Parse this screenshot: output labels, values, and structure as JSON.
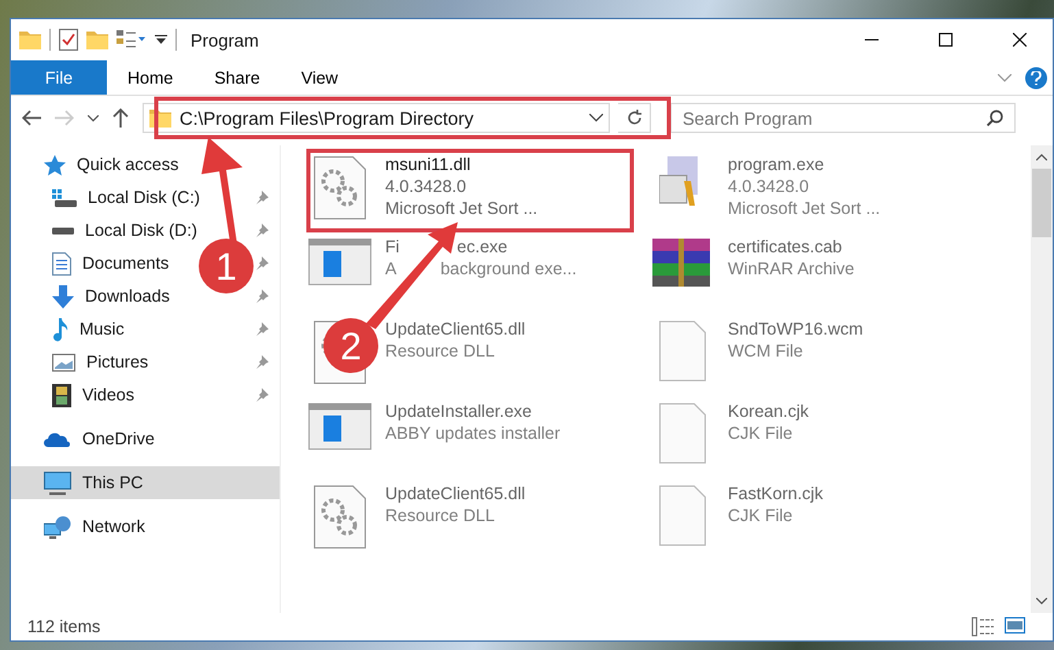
{
  "window": {
    "title": "Program"
  },
  "ribbon": {
    "file_menu": "File",
    "tabs": [
      {
        "label": "Home"
      },
      {
        "label": "Share"
      },
      {
        "label": "View"
      }
    ]
  },
  "address": {
    "path": "C:\\Program Files\\Program Directory"
  },
  "search": {
    "placeholder": "Search Program"
  },
  "sidebar": {
    "items": [
      {
        "label": "Quick access",
        "selected": false,
        "children": [
          {
            "label": "Local Disk (C:)",
            "pinned": true
          },
          {
            "label": "Local Disk (D:)",
            "pinned": true
          },
          {
            "label": "Documents",
            "pinned": true
          },
          {
            "label": "Downloads",
            "pinned": true
          },
          {
            "label": "Music",
            "pinned": true
          },
          {
            "label": "Pictures",
            "pinned": true
          },
          {
            "label": "Videos",
            "pinned": true
          }
        ]
      },
      {
        "label": "OneDrive",
        "selected": false
      },
      {
        "label": "This PC",
        "selected": true
      },
      {
        "label": "Network",
        "selected": false
      }
    ]
  },
  "files": [
    {
      "kind": "dll",
      "name": "msuni11.dll",
      "details": [
        "4.0.3428.0",
        "Microsoft Jet Sort ..."
      ],
      "faded": false
    },
    {
      "kind": "program",
      "name": "program.exe",
      "details": [
        "4.0.3428.0",
        "Microsoft Jet Sort ..."
      ],
      "faded": true
    },
    {
      "kind": "exe",
      "name": [
        "Fi",
        "ec.exe"
      ],
      "details": [
        [
          "A",
          "background exe..."
        ]
      ],
      "faded": true
    },
    {
      "kind": "archive",
      "name": "certificates.cab",
      "details": [
        "WinRAR Archive"
      ],
      "faded": true
    },
    {
      "kind": "dll",
      "name": "UpdateClient65.dll",
      "details": [
        "Resource DLL"
      ],
      "faded": true
    },
    {
      "kind": "file",
      "name": "SndToWP16.wcm",
      "details": [
        "WCM File"
      ],
      "faded": true
    },
    {
      "kind": "exe",
      "name": "UpdateInstaller.exe",
      "details": [
        "ABBY updates installer"
      ],
      "faded": true
    },
    {
      "kind": "file",
      "name": "Korean.cjk",
      "details": [
        "CJK File"
      ],
      "faded": true
    },
    {
      "kind": "dll",
      "name": "UpdateClient65.dll",
      "details": [
        "Resource DLL"
      ],
      "faded": true
    },
    {
      "kind": "file",
      "name": "FastKorn.cjk",
      "details": [
        "CJK File"
      ],
      "faded": true
    }
  ],
  "status_bar": {
    "item_count": "112 items"
  },
  "callouts": [
    {
      "number": "1"
    },
    {
      "number": "2"
    }
  ]
}
